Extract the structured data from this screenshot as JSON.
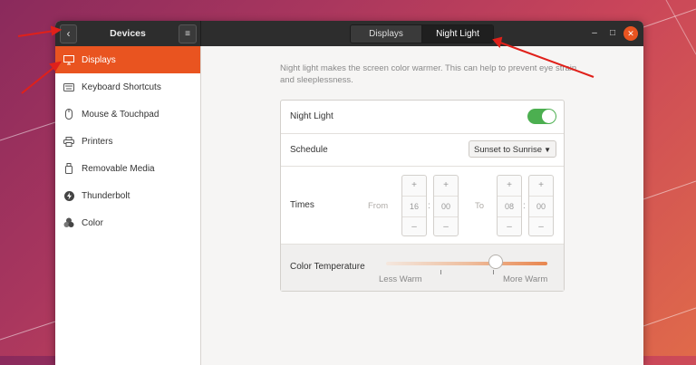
{
  "header": {
    "back_icon": "back-chevron-icon",
    "title": "Devices",
    "menu_icon": "hamburger-menu-icon",
    "tabs": [
      {
        "label": "Displays",
        "active": false
      },
      {
        "label": "Night Light",
        "active": true
      }
    ],
    "minimize_glyph": "–",
    "maximize_glyph": "□",
    "close_glyph": "✕"
  },
  "sidebar": {
    "items": [
      {
        "label": "Displays",
        "icon": "display-icon",
        "active": true
      },
      {
        "label": "Keyboard Shortcuts",
        "icon": "keyboard-icon",
        "active": false
      },
      {
        "label": "Mouse & Touchpad",
        "icon": "mouse-icon",
        "active": false
      },
      {
        "label": "Printers",
        "icon": "printer-icon",
        "active": false
      },
      {
        "label": "Removable Media",
        "icon": "removable-media-icon",
        "active": false
      },
      {
        "label": "Thunderbolt",
        "icon": "thunderbolt-icon",
        "active": false
      },
      {
        "label": "Color",
        "icon": "color-icon",
        "active": false
      }
    ]
  },
  "night_light": {
    "description": "Night light makes the screen color warmer. This can help to prevent eye strain and sleeplessness.",
    "toggle_label": "Night Light",
    "enabled": true,
    "schedule_label": "Schedule",
    "schedule_value": "Sunset to Sunrise",
    "times_label": "Times",
    "from_label": "From",
    "to_label": "To",
    "from_hours": "16",
    "from_minutes": "00",
    "to_hours": "08",
    "to_minutes": "00",
    "plus": "+",
    "minus": "–",
    "colon": ":",
    "temperature_label": "Color Temperature",
    "less_warm_label": "Less Warm",
    "more_warm_label": "More Warm",
    "temperature_fraction": 0.68
  },
  "colors": {
    "accent": "#e95420",
    "toggle_on": "#4caf50",
    "annotation_arrows": "#e0201a"
  }
}
